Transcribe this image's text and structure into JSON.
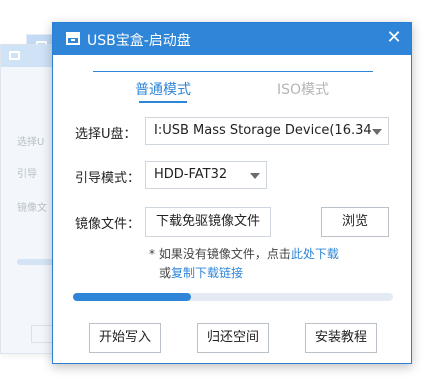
{
  "window": {
    "title": "USB宝盒-启动盘",
    "close_glyph": "✕"
  },
  "tabs": [
    {
      "label": "普通模式",
      "active": true
    },
    {
      "label": "ISO模式",
      "active": false
    }
  ],
  "form": {
    "usb_label": "选择U盘：",
    "usb_value": "I:USB Mass Storage Device(16.34",
    "boot_label": "引导模式：",
    "boot_value": "HDD-FAT32",
    "image_label": "镜像文件：",
    "download_button": "下载免驱镜像文件",
    "browse_button": "浏览"
  },
  "note": {
    "prefix": "* 如果没有镜像文件，点击",
    "link1": "此处下载",
    "middle": "或",
    "link2": "复制下载链接"
  },
  "progress": {
    "fraction": 0.37
  },
  "actions": {
    "start_write": "开始写入",
    "restore_space": "归还空间",
    "tutorial": "安装教程"
  },
  "background_window": {
    "labels": [
      "选择U",
      "引导",
      "镜像文"
    ]
  },
  "colors": {
    "accent": "#2f86d8",
    "tab_inactive": "#b5b5b5"
  }
}
